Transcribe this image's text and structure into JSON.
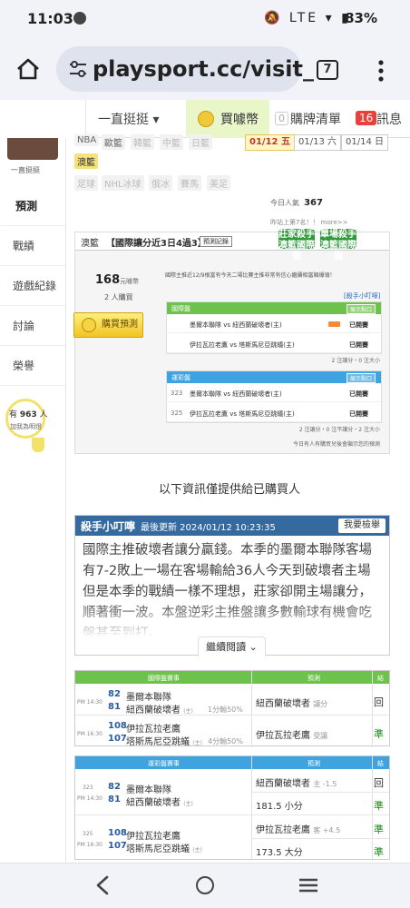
{
  "status_bar": {
    "time": "11:03",
    "battery": "83%",
    "icons": "🔕 LTE ▾ ▮"
  },
  "browser": {
    "url": "playsport.cc/visit_",
    "tab_count": "7"
  },
  "site_nav": {
    "user_menu": "一直挺挺 ▾",
    "buy_label": "買噱幣",
    "cart_count": "0",
    "cart_label": "購牌清單",
    "msg_count": "16",
    "msg_label": "訊息"
  },
  "sidebar": {
    "avatar_name": "一直挺挺",
    "items": [
      "預測",
      "戰績",
      "遊戲紀錄",
      "討論",
      "榮譽"
    ],
    "fan_count_prefix": "有",
    "fan_count": "963",
    "fan_count_suffix": "人",
    "fan_sub": "加我為明燈"
  },
  "league_chips": {
    "row1": [
      "NBA",
      "歐籃",
      "韓籃",
      "中籃",
      "日籃"
    ],
    "row2": [
      "澳籃"
    ],
    "row3": [
      "足球",
      "NHL冰球",
      "俄冰",
      "賽馬",
      "美足"
    ]
  },
  "dates": [
    {
      "label": "01/12 五",
      "active": true
    },
    {
      "label": "01/13 六",
      "active": false
    },
    {
      "label": "01/14 日",
      "active": false
    }
  ],
  "today": {
    "label": "今日人氣",
    "value": "367",
    "rank": "昨站上第7名！！ more>>"
  },
  "prediction": {
    "league": "澳籃",
    "title": "【國際讓分近3日4過3】",
    "stats_btn": "預測記錄",
    "badge_1": "莊家殺手 澳籃國際盤",
    "badge_2": "單場殺手 澳籃國際盤",
    "price": "168",
    "price_unit": "元噱幣",
    "buyers": "2 人購買",
    "buy_button": "購買預測",
    "notice": "國際主推近12/9根當有今天二場比賽主推非常有信心繼續相當順爆領！",
    "tip_link": "[殺手小叮嚀]",
    "intl_box": {
      "title": "國際盤",
      "btn": "展示點口",
      "rows": [
        {
          "teams": "墨爾本聯隊 vs 紐西蘭破壞者(主)",
          "stat": "已開賽"
        },
        {
          "teams": "伊拉瓦拉老鷹 vs 塔斯馬尼亞跳蟻(主)",
          "stat": "已開賽"
        }
      ],
      "footer": "2 注讓分・0 注大小"
    },
    "local_box": {
      "title": "運彩盤",
      "btn": "展示點口",
      "rows": [
        {
          "num": "323",
          "teams": "墨爾本聯隊 vs 紐西蘭破壞者(主)",
          "stat": "已開賽"
        },
        {
          "num": "325",
          "teams": "伊拉瓦拉老鷹 vs 塔斯馬尼亞跳蟻(主)",
          "stat": "已開賽"
        }
      ],
      "footer": "2 注讓分・0 注不讓分・2 注大小",
      "footer2": "今日有人有購買兒後會顯示您的預測"
    }
  },
  "purchasers_note": "以下資訊僅提供給已購買人",
  "tip": {
    "title": "殺手小叮嚀",
    "updated": "最後更新 2024/01/12 10:23:35",
    "check_btn": "我要檢舉",
    "body": "國際主推破壞者讓分贏錢。本季的墨爾本聯隊客場有7-2敗上一場在客場輸給36人今天到破壞者主場但是本季的戰績一樣不理想，莊家卻開主場讓分，順著衝一波。本盤逆彩主推盤讓多數輸球有機會吃盤甚至到打。",
    "continue": "繼續閱讀"
  },
  "intl_table": {
    "headers": [
      "國際盤賽事",
      "預測",
      "結果"
    ],
    "rows": [
      {
        "time": "PM 14:30",
        "rot1": "82",
        "team1": "墨爾本聯隊",
        "rot2": "81",
        "team2": "紐西蘭破壞者",
        "team2_tag": "(主)",
        "line": "1分輸50%",
        "pick": "紐西蘭破壞者",
        "pick_tag": "讓分",
        "result": "回",
        "result_color": "#333333"
      },
      {
        "time": "PM 16:30",
        "rot1": "108",
        "team1": "伊拉瓦拉老鷹",
        "rot2": "107",
        "team2": "塔斯馬尼亞跳蟻",
        "team2_tag": "(主)",
        "line": "4分輸50%",
        "pick": "伊拉瓦拉老鷹",
        "pick_tag": "受讓",
        "result": "準",
        "result_color": "#1a8a1a"
      }
    ]
  },
  "local_table": {
    "headers": [
      "運彩盤賽事",
      "預測",
      "結果"
    ],
    "rows": [
      {
        "num": "323",
        "time": "PM 14:30",
        "rot1": "82",
        "team1": "墨爾本聯隊",
        "rot2": "81",
        "team2": "紐西蘭破壞者",
        "team2_tag": "(主)",
        "pick1": "紐西蘭破壞者",
        "pick1_tag": "主 -1.5",
        "result1": "回",
        "pick2": "181.5 小分",
        "result2": "準"
      },
      {
        "num": "325",
        "time": "PM 16:30",
        "rot1": "108",
        "team1": "伊拉瓦拉老鷹",
        "rot2": "107",
        "team2": "塔斯馬尼亞跳蟻",
        "team2_tag": "(主)",
        "pick1": "伊拉瓦拉老鷹",
        "pick1_tag": "客 +4.5",
        "result1": "準",
        "pick2": "173.5 大分",
        "result2": "準"
      }
    ]
  },
  "colors": {
    "green_head": "#6cc24a",
    "blue_head": "#3fa3e0",
    "tip_head": "#356aa1",
    "result_green": "#1a8a1a",
    "active_date": "#c0392b"
  }
}
